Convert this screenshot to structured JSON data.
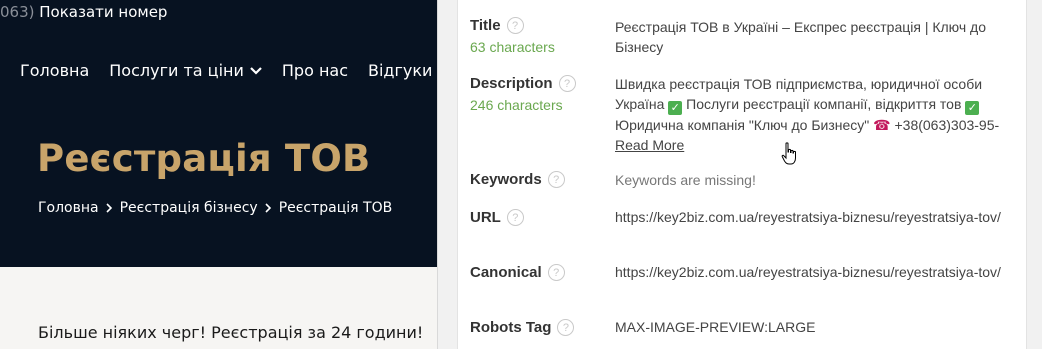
{
  "site": {
    "topbar": {
      "prefix": "063)",
      "show_number": "Показати номер"
    },
    "nav": [
      "Головна",
      "Послуги та ціни",
      "Про нас",
      "Відгуки"
    ],
    "hero_title": "Реєстрація ТОВ",
    "breadcrumbs": [
      "Головна",
      "Реєстрація бізнесу",
      "Реєстрація ТОВ"
    ],
    "promo": "Більше ніяких черг! Реєстрація за 24 години!"
  },
  "seo": {
    "title": {
      "label": "Title",
      "count": "63 characters",
      "value": "Реєстрація ТОВ в Україні – Експрес реєстрація | Ключ до Бізнесу"
    },
    "description": {
      "label": "Description",
      "count": "246 characters",
      "part1": "Швидка реєстрація ТОВ підприємства, юридичної особи Україна",
      "part2": "Послуги реєстрації компанії, відкриття тов",
      "part3": "Юридична компанія \"Ключ до Бизнесу\"",
      "phone": "+38(063)303-95-",
      "read_more": "Read More"
    },
    "keywords": {
      "label": "Keywords",
      "value": "Keywords are missing!"
    },
    "url": {
      "label": "URL",
      "value": "https://key2biz.com.ua/reyestratsiya-biznesu/reyestratsiya-tov/"
    },
    "canonical": {
      "label": "Canonical",
      "value": "https://key2biz.com.ua/reyestratsiya-biznesu/reyestratsiya-tov/"
    },
    "robots": {
      "label": "Robots Tag",
      "value": "MAX-IMAGE-PREVIEW:LARGE"
    }
  },
  "colors": {
    "site_bg": "#071221",
    "accent_gold": "#c8a46a",
    "count_green": "#6aa84f"
  },
  "icons": {
    "help": "question-circle-icon",
    "check": "green-check-icon",
    "phone": "telephone-icon",
    "cursor": "hand-pointer-icon"
  }
}
